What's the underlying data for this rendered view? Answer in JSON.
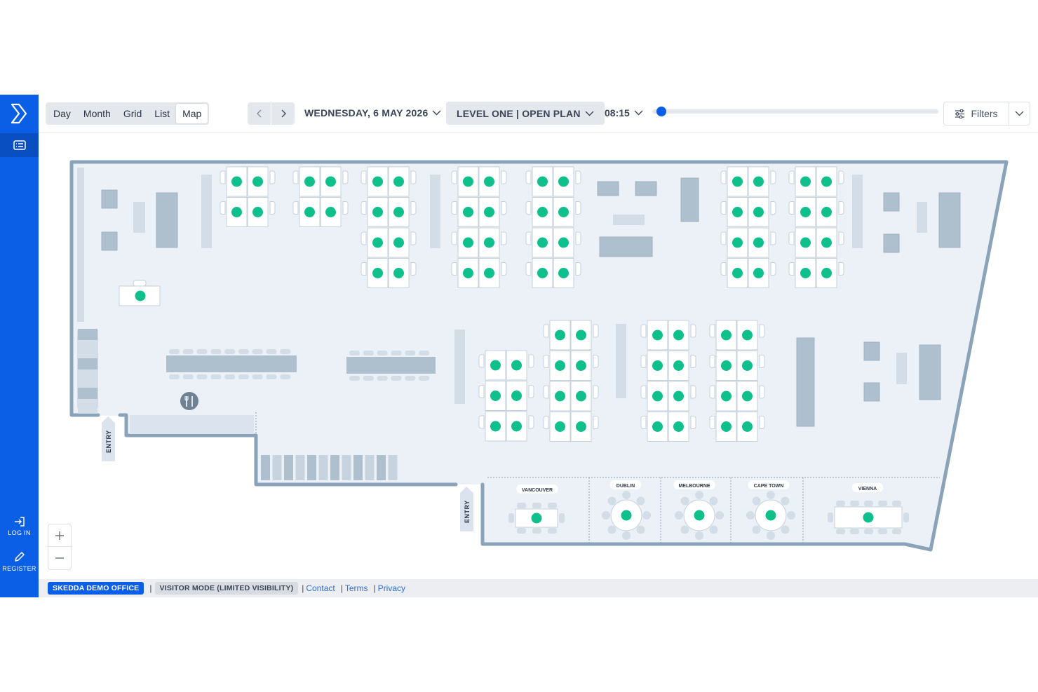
{
  "views": [
    {
      "label": "Day",
      "active": false
    },
    {
      "label": "Month",
      "active": false
    },
    {
      "label": "Grid",
      "active": false
    },
    {
      "label": "List",
      "active": false
    },
    {
      "label": "Map",
      "active": true
    }
  ],
  "date_label": "WEDNESDAY, 6 MAY 2026",
  "level_label": "LEVEL ONE | OPEN PLAN",
  "time_label": "08:15",
  "time_slider_fraction": 0.02,
  "filters_label": "Filters",
  "sidebar": {
    "login_label": "LOG IN",
    "register_label": "REGISTER"
  },
  "rooms": [
    "VANCOUVER",
    "DUBLIN",
    "MELBOURNE",
    "CAPE TOWN",
    "VIENNA"
  ],
  "entry_label": "ENTRY",
  "zoom": {
    "in": "+",
    "out": "−"
  },
  "footer": {
    "venue": "SKEDDA DEMO OFFICE",
    "mode": "VISITOR MODE (LIMITED VISIBILITY)",
    "links": [
      "Contact",
      "Terms",
      "Privacy"
    ]
  },
  "colors": {
    "brand": "#0b5fe6",
    "available": "#0fbf8c",
    "wall": "#8aa3b8",
    "floor": "#ecf1f7"
  }
}
